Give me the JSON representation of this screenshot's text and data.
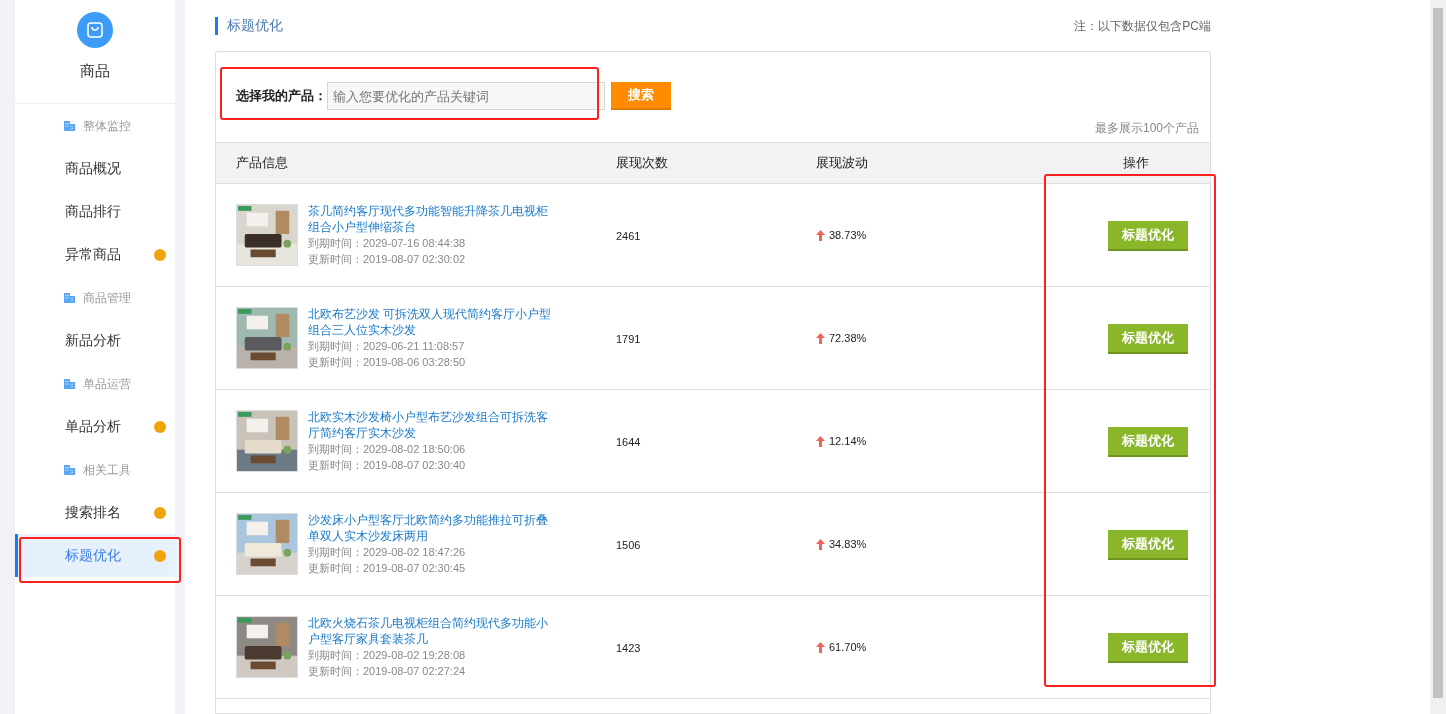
{
  "sidebar": {
    "title": "商品",
    "groups": [
      {
        "label": "整体监控",
        "items": [
          {
            "label": "商品概况",
            "selected": false,
            "badge": false
          },
          {
            "label": "商品排行",
            "selected": false,
            "badge": false
          },
          {
            "label": "异常商品",
            "selected": false,
            "badge": true
          }
        ]
      },
      {
        "label": "商品管理",
        "items": [
          {
            "label": "新品分析",
            "selected": false,
            "badge": false
          }
        ]
      },
      {
        "label": "单品运营",
        "items": [
          {
            "label": "单品分析",
            "selected": false,
            "badge": true
          }
        ]
      },
      {
        "label": "相关工具",
        "items": [
          {
            "label": "搜索排名",
            "selected": false,
            "badge": true
          },
          {
            "label": "标题优化",
            "selected": true,
            "badge": true
          }
        ]
      }
    ]
  },
  "page_title": "标题优化",
  "note": "注：以下数据仅包含PC端",
  "search": {
    "label": "选择我的产品：",
    "placeholder": "输入您要优化的产品关键词",
    "button": "搜索"
  },
  "limit_note": "最多展示100个产品",
  "table": {
    "columns": [
      "产品信息",
      "展现次数",
      "展现波动",
      "操作"
    ],
    "rows": [
      {
        "title": "茶几简约客厅现代多功能智能升降茶几电视柜组合小户型伸缩茶台",
        "expire": "到期时间：2029-07-16 08:44:38",
        "updated": "更新时间：2019-08-07 02:30:02",
        "views": "2461",
        "kind": "up",
        "change": "38.73%",
        "action": "标题优化"
      },
      {
        "title": "北欧布艺沙发 可拆洗双人现代简约客厅小户型组合三人位实木沙发",
        "expire": "到期时间：2029-06-21 11:08:57",
        "updated": "更新时间：2019-08-06 03:28:50",
        "views": "1791",
        "kind": "up",
        "change": "72.38%",
        "action": "标题优化"
      },
      {
        "title": "北欧实木沙发椅小户型布艺沙发组合可拆洗客厅简约客厅实木沙发",
        "expire": "到期时间：2029-08-02 18:50:06",
        "updated": "更新时间：2019-08-07 02:30:40",
        "views": "1644",
        "kind": "up",
        "change": "12.14%",
        "action": "标题优化"
      },
      {
        "title": "沙发床小户型客厅北欧简约多功能推拉可折叠单双人实木沙发床两用",
        "expire": "到期时间：2029-08-02 18:47:26",
        "updated": "更新时间：2019-08-07 02:30:45",
        "views": "1506",
        "kind": "up",
        "change": "34.83%",
        "action": "标题优化"
      },
      {
        "title": "北欧火烧石茶几电视柜组合简约现代多功能小户型客厅家具套装茶几",
        "expire": "到期时间：2029-08-02 19:28:08",
        "updated": "更新时间：2019-08-07 02:27:24",
        "views": "1423",
        "kind": "up",
        "change": "61.70%",
        "action": "标题优化"
      }
    ]
  }
}
